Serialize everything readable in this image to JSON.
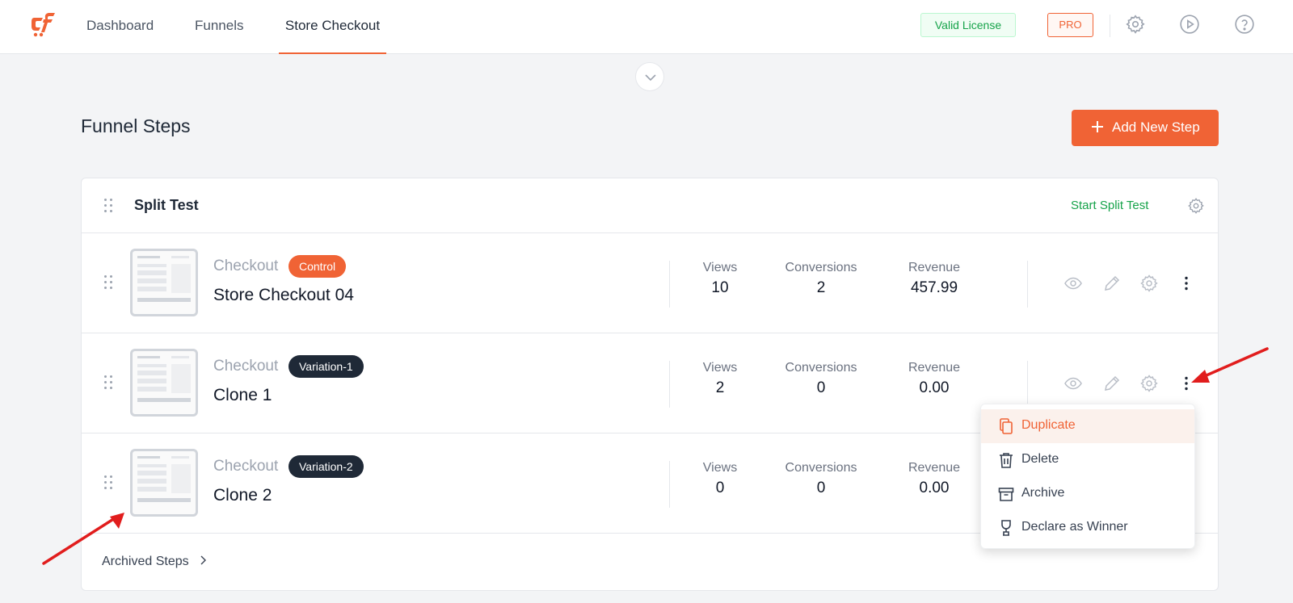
{
  "nav": {
    "tabs": [
      {
        "label": "Dashboard"
      },
      {
        "label": "Funnels"
      },
      {
        "label": "Store Checkout"
      }
    ],
    "license_badge": "Valid License",
    "pro_badge": "PRO"
  },
  "page": {
    "title": "Funnel Steps",
    "add_button": "Add New Step"
  },
  "split_test": {
    "title": "Split Test",
    "start_label": "Start Split Test",
    "stat_labels": {
      "views": "Views",
      "conversions": "Conversions",
      "revenue": "Revenue"
    },
    "steps": [
      {
        "type": "Checkout",
        "badge": "Control",
        "name": "Store Checkout 04",
        "views": "10",
        "conversions": "2",
        "revenue": "457.99"
      },
      {
        "type": "Checkout",
        "badge": "Variation-1",
        "name": "Clone 1",
        "views": "2",
        "conversions": "0",
        "revenue": "0.00"
      },
      {
        "type": "Checkout",
        "badge": "Variation-2",
        "name": "Clone 2",
        "views": "0",
        "conversions": "0",
        "revenue": "0.00"
      }
    ],
    "archived_label": "Archived Steps"
  },
  "context_menu": {
    "items": [
      {
        "label": "Duplicate",
        "icon": "duplicate-icon"
      },
      {
        "label": "Delete",
        "icon": "trash-icon"
      },
      {
        "label": "Archive",
        "icon": "archive-icon"
      },
      {
        "label": "Declare as Winner",
        "icon": "trophy-icon"
      }
    ]
  },
  "colors": {
    "accent": "#f06335",
    "success": "#16a34a",
    "dark_badge": "#1f2937",
    "annotation_arrow": "#e11d1d"
  }
}
